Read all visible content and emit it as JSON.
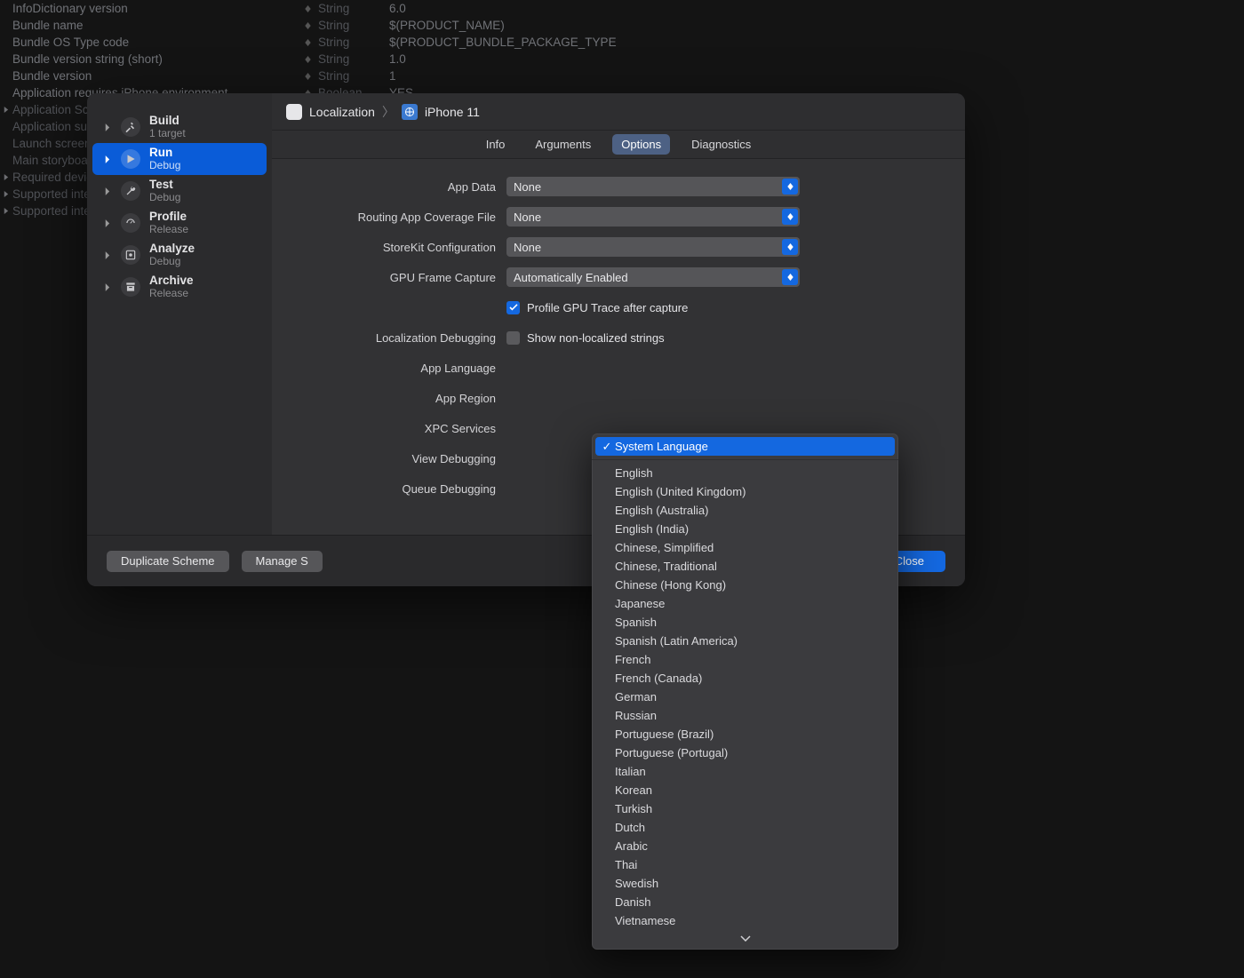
{
  "plist": {
    "rows": [
      {
        "key": "InfoDictionary version",
        "type": "String",
        "value": "6.0"
      },
      {
        "key": "Bundle name",
        "type": "String",
        "value": "$(PRODUCT_NAME)"
      },
      {
        "key": "Bundle OS Type code",
        "type": "String",
        "value": "$(PRODUCT_BUNDLE_PACKAGE_TYPE"
      },
      {
        "key": "Bundle version string (short)",
        "type": "String",
        "value": "1.0"
      },
      {
        "key": "Bundle version",
        "type": "String",
        "value": "1"
      },
      {
        "key": "Application requires iPhone environment",
        "type": "Boolean",
        "value": "YES"
      }
    ],
    "expandable": [
      "Application Sc",
      "Application su",
      "Launch screen",
      "Main storyboa",
      "Required devic",
      "Supported inte",
      "Supported inte"
    ]
  },
  "sidebar": {
    "items": [
      {
        "title": "Build",
        "sub": "1 target",
        "icon": "hammer"
      },
      {
        "title": "Run",
        "sub": "Debug",
        "icon": "play"
      },
      {
        "title": "Test",
        "sub": "Debug",
        "icon": "wrench"
      },
      {
        "title": "Profile",
        "sub": "Release",
        "icon": "gauge"
      },
      {
        "title": "Analyze",
        "sub": "Debug",
        "icon": "lens"
      },
      {
        "title": "Archive",
        "sub": "Release",
        "icon": "archive"
      }
    ]
  },
  "breadcrumb": {
    "app": "Localization",
    "device": "iPhone 11"
  },
  "tabs": [
    "Info",
    "Arguments",
    "Options",
    "Diagnostics"
  ],
  "activeTab": "Options",
  "form": {
    "app_data_label": "App Data",
    "app_data_value": "None",
    "routing_label": "Routing App Coverage File",
    "routing_value": "None",
    "storekit_label": "StoreKit Configuration",
    "storekit_value": "None",
    "gpu_label": "GPU Frame Capture",
    "gpu_value": "Automatically Enabled",
    "profile_gpu_label": "Profile GPU Trace after capture",
    "loc_debug_label": "Localization Debugging",
    "loc_debug_check_label": "Show non-localized strings",
    "app_lang_label": "App Language",
    "app_region_label": "App Region",
    "xpc_label": "XPC Services",
    "view_debug_label": "View Debugging",
    "queue_debug_label": "Queue Debugging"
  },
  "footer": {
    "duplicate": "Duplicate Scheme",
    "manage": "Manage S",
    "close": "Close"
  },
  "dropdown": {
    "selected": "System Language",
    "items": [
      "English",
      "English (United Kingdom)",
      "English (Australia)",
      "English (India)",
      "Chinese, Simplified",
      "Chinese, Traditional",
      "Chinese (Hong Kong)",
      "Japanese",
      "Spanish",
      "Spanish (Latin America)",
      "French",
      "French (Canada)",
      "German",
      "Russian",
      "Portuguese (Brazil)",
      "Portuguese (Portugal)",
      "Italian",
      "Korean",
      "Turkish",
      "Dutch",
      "Arabic",
      "Thai",
      "Swedish",
      "Danish",
      "Vietnamese"
    ]
  }
}
